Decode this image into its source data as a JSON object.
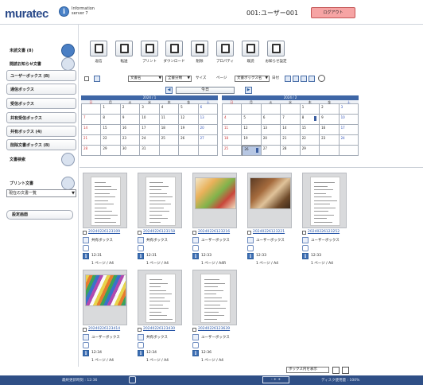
{
  "header": {
    "logo": "muratec",
    "info_line1": "Information",
    "info_line2": "server 7",
    "info_badge": "i",
    "title": "001:ユーザー001",
    "logout_label": "ログアウト"
  },
  "sidebar": {
    "items": [
      {
        "label": "未読文書 (8)",
        "icon": "mail-icon"
      },
      {
        "label": "閲読お知らせ文書",
        "icon": "bell-icon"
      },
      {
        "label": "ユーザーボックス (8)"
      },
      {
        "label": "通信ボックス"
      },
      {
        "label": "受信ボックス"
      },
      {
        "label": "共有受信ボックス"
      },
      {
        "label": "共有ボックス (4)"
      },
      {
        "label": "削除文書ボックス (8)"
      },
      {
        "label": "文書検索",
        "icon": "search-icon"
      },
      {
        "label": "プリント文書",
        "icon": "print-icon"
      }
    ],
    "select_value": "現在の文書一覧",
    "settings_label": "設定画面"
  },
  "toolbar": {
    "buttons": [
      {
        "label": "返信",
        "icon": "reply-icon"
      },
      {
        "label": "転送",
        "icon": "forward-icon"
      },
      {
        "label": "プリント",
        "icon": "print-icon"
      },
      {
        "label": "ダウンロード",
        "icon": "download-icon"
      },
      {
        "label": "削除",
        "icon": "trash-icon"
      },
      {
        "label": "プロパティ",
        "icon": "properties-icon"
      },
      {
        "label": "既読",
        "icon": "read-icon"
      },
      {
        "label": "お知らせ設定",
        "icon": "timer-icon"
      }
    ]
  },
  "filter": {
    "doc_name": "文書名",
    "all_category": "全書分類",
    "size_label": "サイズ",
    "page_label": "ページ",
    "box_name": "文書ボックス名",
    "date_label": "日付"
  },
  "calendar": {
    "today_label": "今日",
    "weekdays": [
      "日",
      "月",
      "火",
      "水",
      "木",
      "金",
      "土"
    ],
    "months": [
      {
        "title": "2024 / 1",
        "weeks": [
          [
            "",
            "1",
            "2",
            "3",
            "4",
            "5",
            "6"
          ],
          [
            "7",
            "8",
            "9",
            "10",
            "11",
            "12",
            "13"
          ],
          [
            "14",
            "15",
            "16",
            "17",
            "18",
            "19",
            "20"
          ],
          [
            "21",
            "22",
            "23",
            "24",
            "25",
            "26",
            "27"
          ],
          [
            "28",
            "29",
            "30",
            "31",
            "",
            "",
            ""
          ]
        ]
      },
      {
        "title": "2024 / 2",
        "weeks": [
          [
            "",
            "",
            "",
            "",
            "1",
            "2",
            "3"
          ],
          [
            "4",
            "5",
            "6",
            "7",
            "8",
            "9",
            "10"
          ],
          [
            "11",
            "12",
            "13",
            "14",
            "15",
            "16",
            "17"
          ],
          [
            "18",
            "19",
            "20",
            "21",
            "22",
            "23",
            "24"
          ],
          [
            "25",
            "26",
            "27",
            "28",
            "29",
            "",
            ""
          ]
        ],
        "selected": "26",
        "marked": [
          "8",
          "26"
        ]
      }
    ]
  },
  "documents": [
    {
      "name": "20240226123109",
      "box": "共有ボックス",
      "time": "12:31",
      "pages": "1 ページ / A4",
      "thumb": "doc"
    },
    {
      "name": "20240226123158",
      "box": "共有ボックス",
      "time": "12:31",
      "pages": "1 ページ / A4",
      "thumb": "doc"
    },
    {
      "name": "20240226123216",
      "box": "ユーザーボックス",
      "time": "12:33",
      "pages": "1 ページ / A4R",
      "thumb": "photo-food"
    },
    {
      "name": "20240226123221",
      "box": "ユーザーボックス",
      "time": "12:33",
      "pages": "1 ページ / A4",
      "thumb": "photo-craft"
    },
    {
      "name": "20240226123252",
      "box": "ユーザーボックス",
      "time": "12:33",
      "pages": "1 ページ / A4",
      "thumb": "doc"
    },
    {
      "name": "20240226123414",
      "box": "ユーザーボックス",
      "time": "12:34",
      "pages": "1 ページ / A4",
      "thumb": "photo-pens"
    },
    {
      "name": "20240226123430",
      "box": "共有ボックス",
      "time": "12:34",
      "pages": "1 ページ / A4",
      "thumb": "doc"
    },
    {
      "name": "20240226123639",
      "box": "ユーザーボックス",
      "time": "12:36",
      "pages": "1 ページ / A4",
      "thumb": "doc"
    }
  ],
  "bottom": {
    "display_select": "ボックス内を表示"
  },
  "status": {
    "left_text": "最終更新時刻 : 12:36",
    "zoom": "- + +",
    "right_text": "ディスク使用量 : 100%"
  },
  "colors": {
    "brand": "#2a4a8a",
    "accent": "#3e66a6",
    "logout": "#f6a4a4",
    "statusbar": "#2f4f86"
  }
}
